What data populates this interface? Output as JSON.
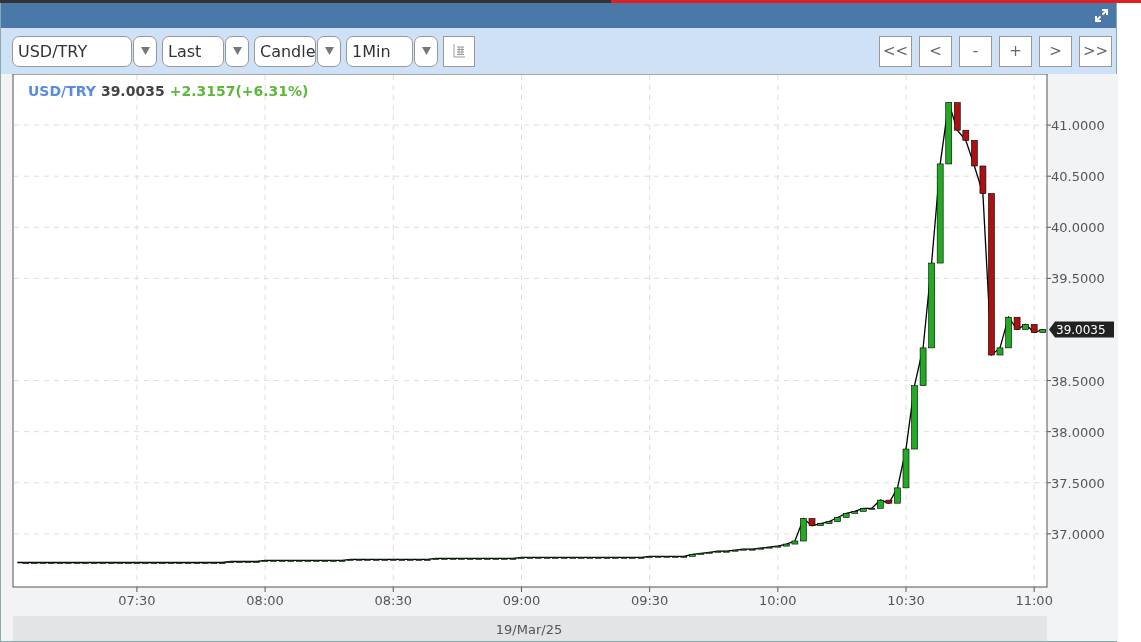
{
  "toolbar": {
    "dropdowns": [
      {
        "value": "USD/TRY"
      },
      {
        "value": "Last"
      },
      {
        "value": "Candle"
      },
      {
        "value": "1Min"
      }
    ],
    "nav_buttons": [
      "<<",
      "<",
      "-",
      "+",
      ">",
      ">>"
    ]
  },
  "legend": {
    "price": "39.0035",
    "change": "+2.3157(+6.31%)"
  },
  "last_price_tag": "39.0035",
  "date_label": "19/Mar/25",
  "chart_data": {
    "type": "line",
    "categories": [
      null,
      null,
      null,
      null,
      null,
      null,
      null,
      null,
      null,
      null,
      null,
      null,
      null,
      null,
      "07:30",
      null,
      null,
      null,
      null,
      null,
      null,
      null,
      null,
      null,
      null,
      null,
      null,
      null,
      null,
      "08:00",
      null,
      null,
      null,
      null,
      null,
      null,
      null,
      null,
      null,
      null,
      null,
      null,
      null,
      null,
      "08:30",
      null,
      null,
      null,
      null,
      null,
      null,
      null,
      null,
      null,
      null,
      null,
      null,
      null,
      null,
      "09:00",
      null,
      null,
      null,
      null,
      null,
      null,
      null,
      null,
      null,
      null,
      null,
      null,
      null,
      null,
      "09:30",
      null,
      null,
      null,
      null,
      null,
      null,
      null,
      null,
      null,
      null,
      null,
      null,
      null,
      null,
      "10:00",
      null,
      null,
      null,
      null,
      null,
      null,
      null,
      null,
      null,
      null,
      null,
      null,
      null,
      null,
      "10:30",
      null,
      null,
      null,
      null,
      null,
      null,
      null,
      null,
      null,
      null,
      null,
      null,
      null,
      null,
      "11:00",
      null
    ],
    "grid": true,
    "ylim": [
      36.48,
      41.5
    ],
    "yticks": [
      {
        "value": 37,
        "label": "37.0000"
      },
      {
        "value": 37.5,
        "label": "37.5000"
      },
      {
        "value": 38,
        "label": "38.0000"
      },
      {
        "value": 38.5,
        "label": "38.5000"
      },
      {
        "value": 39.5,
        "label": "39.5000"
      },
      {
        "value": 40,
        "label": "40.0000"
      },
      {
        "value": 40.5,
        "label": "40.5000"
      },
      {
        "value": 41,
        "label": "41.0000"
      }
    ],
    "series": [
      {
        "name": "USD/TRY",
        "color": "#000000",
        "values": [
          36.72,
          36.72,
          36.72,
          36.72,
          36.72,
          36.72,
          36.72,
          36.72,
          36.72,
          36.72,
          36.72,
          36.72,
          36.72,
          36.72,
          36.72,
          36.72,
          36.72,
          36.72,
          36.72,
          36.72,
          36.72,
          36.72,
          36.72,
          36.72,
          36.72,
          36.73,
          36.73,
          36.73,
          36.73,
          36.74,
          36.74,
          36.74,
          36.74,
          36.74,
          36.74,
          36.74,
          36.74,
          36.74,
          36.74,
          36.75,
          36.75,
          36.75,
          36.75,
          36.75,
          36.75,
          36.75,
          36.75,
          36.75,
          36.75,
          36.76,
          36.76,
          36.76,
          36.76,
          36.76,
          36.76,
          36.76,
          36.76,
          36.76,
          36.76,
          36.77,
          36.77,
          36.77,
          36.77,
          36.77,
          36.77,
          36.77,
          36.77,
          36.77,
          36.77,
          36.77,
          36.77,
          36.77,
          36.77,
          36.77,
          36.78,
          36.78,
          36.78,
          36.78,
          36.78,
          36.8,
          36.81,
          36.82,
          36.83,
          36.83,
          36.84,
          36.85,
          36.85,
          36.86,
          36.87,
          36.88,
          36.9,
          36.93,
          37.15,
          37.08,
          37.1,
          37.12,
          37.16,
          37.2,
          37.22,
          37.25,
          37.25,
          37.33,
          37.3,
          37.45,
          37.83,
          38.45,
          38.82,
          39.65,
          40.62,
          41.22,
          40.95,
          40.85,
          40.6,
          40.33,
          38.75,
          38.82,
          39.12,
          39.0,
          39.05,
          38.97,
          39.0
        ]
      }
    ]
  }
}
